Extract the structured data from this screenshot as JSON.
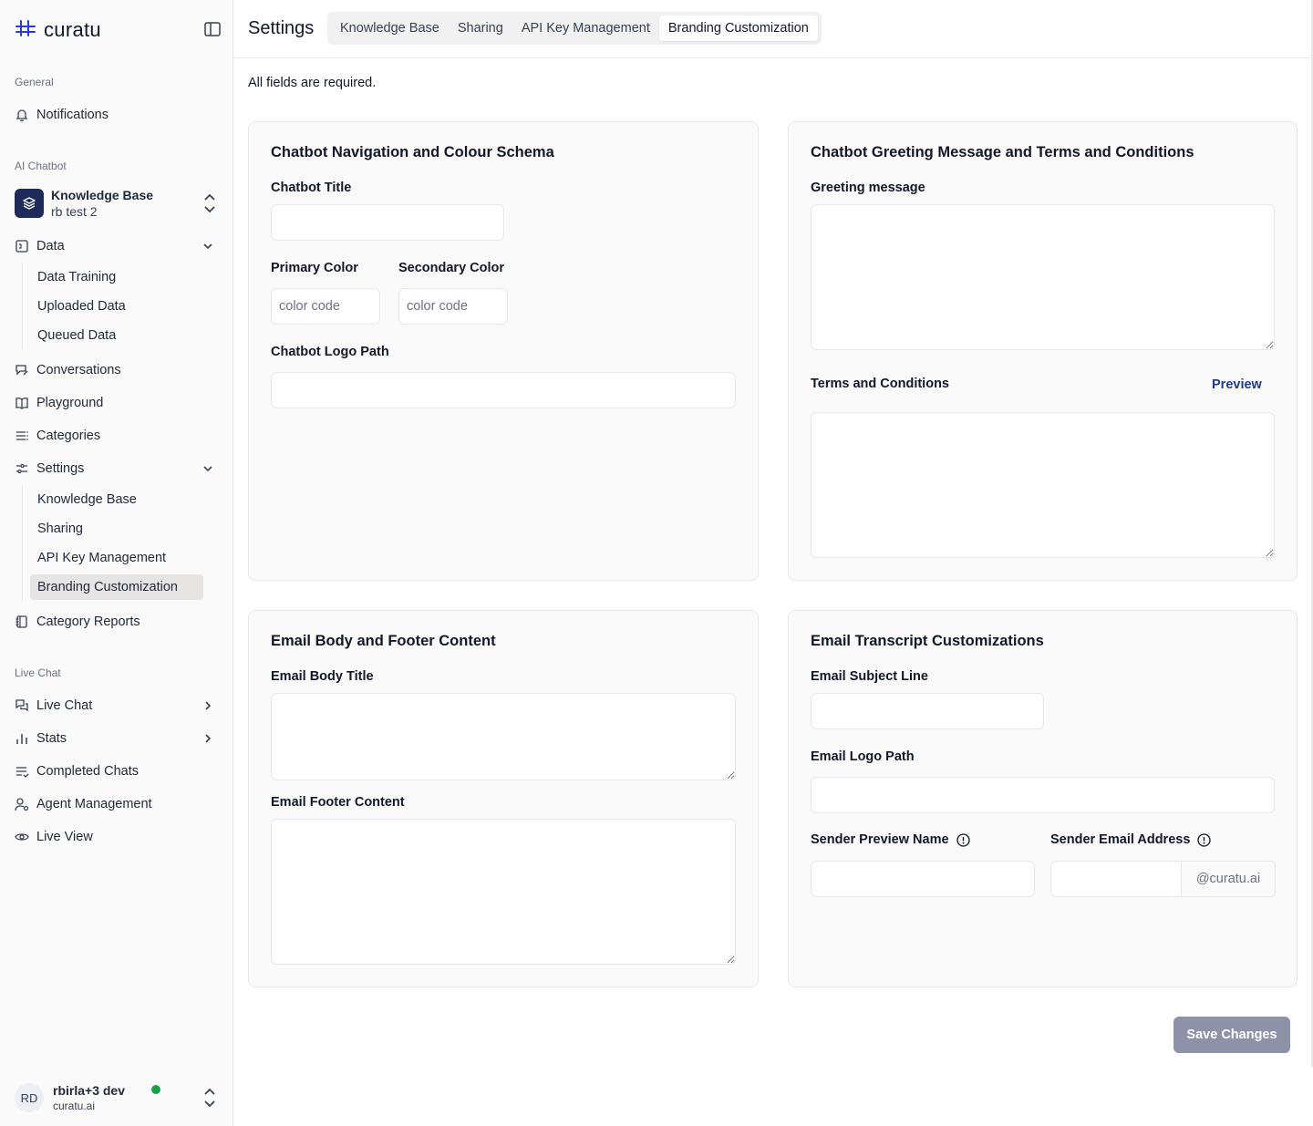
{
  "app": {
    "name": "curatu"
  },
  "sidebar": {
    "general_label": "General",
    "notifications": "Notifications",
    "ai_chatbot_label": "AI Chatbot",
    "kb_switch": {
      "title": "Knowledge Base",
      "subtitle": "rb test 2"
    },
    "data": {
      "label": "Data",
      "items": [
        "Data Training",
        "Uploaded Data",
        "Queued Data"
      ]
    },
    "conversations": "Conversations",
    "playground": "Playground",
    "categories": "Categories",
    "settings": {
      "label": "Settings",
      "items": [
        "Knowledge Base",
        "Sharing",
        "API Key Management",
        "Branding Customization"
      ],
      "active": "Branding Customization"
    },
    "category_reports": "Category Reports",
    "live_chat_label": "Live Chat",
    "live_chat": "Live Chat",
    "stats": "Stats",
    "completed_chats": "Completed Chats",
    "agent_management": "Agent Management",
    "live_view": "Live View",
    "user": {
      "initials": "RD",
      "name": "rbirla+3 dev",
      "org": "curatu.ai",
      "status_color": "#16a34a"
    }
  },
  "header": {
    "title": "Settings",
    "tabs": [
      "Knowledge Base",
      "Sharing",
      "API Key Management",
      "Branding Customization"
    ],
    "active_tab": "Branding Customization"
  },
  "main": {
    "required_note": "All fields are required.",
    "nav_card": {
      "title": "Chatbot Navigation and Colour Schema",
      "chatbot_title_label": "Chatbot Title",
      "chatbot_title_value": "",
      "primary_color_label": "Primary Color",
      "primary_color_placeholder": "color code",
      "secondary_color_label": "Secondary Color",
      "secondary_color_placeholder": "color code",
      "logo_path_label": "Chatbot Logo Path",
      "logo_path_value": ""
    },
    "greeting_card": {
      "title": "Chatbot Greeting Message and Terms and Conditions",
      "greeting_label": "Greeting message",
      "terms_label": "Terms and Conditions",
      "preview_link": "Preview"
    },
    "email_body_card": {
      "title": "Email Body and Footer Content",
      "body_title_label": "Email Body Title",
      "footer_label": "Email Footer Content"
    },
    "transcript_card": {
      "title": "Email Transcript Customizations",
      "subject_label": "Email Subject Line",
      "logo_path_label": "Email Logo Path",
      "sender_name_label": "Sender Preview Name",
      "sender_email_label": "Sender Email Address",
      "email_suffix": "@curatu.ai"
    },
    "save_button": "Save Changes"
  },
  "colors": {
    "brand_navy": "#1e2a5a",
    "save_button": "#8d92a8",
    "link": "#1e3a8a",
    "active_bg": "#e7e5e4"
  }
}
